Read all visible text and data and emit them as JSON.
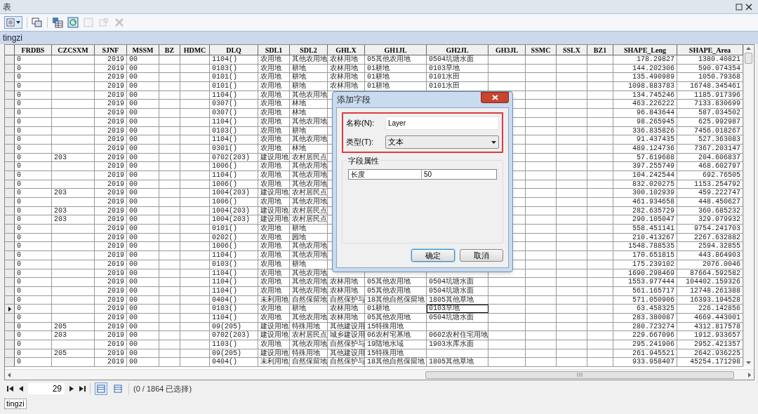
{
  "window": {
    "title": "表"
  },
  "table_tab": "tingzi",
  "columns": [
    {
      "label": "FRDBS",
      "kind": "text",
      "focused": false
    },
    {
      "label": "CZCSXM",
      "kind": "text",
      "focused": false
    },
    {
      "label": "SJNF",
      "kind": "number",
      "focused": false
    },
    {
      "label": "MSSM",
      "kind": "text",
      "focused": false
    },
    {
      "label": "BZ",
      "kind": "text",
      "focused": false
    },
    {
      "label": "HDMC",
      "kind": "text",
      "focused": false
    },
    {
      "label": "DLQ",
      "kind": "text",
      "focused": false
    },
    {
      "label": "SDL1",
      "kind": "text",
      "focused": false
    },
    {
      "label": "SDL2",
      "kind": "text",
      "focused": false
    },
    {
      "label": "GHLX",
      "kind": "text",
      "focused": false
    },
    {
      "label": "GH1JL",
      "kind": "text",
      "focused": false
    },
    {
      "label": "GH2JL",
      "kind": "text",
      "focused": true
    },
    {
      "label": "GH3JL",
      "kind": "text",
      "focused": false
    },
    {
      "label": "SSMC",
      "kind": "text",
      "focused": false
    },
    {
      "label": "SSLX",
      "kind": "text",
      "focused": false
    },
    {
      "label": "BZ1",
      "kind": "text",
      "focused": false
    },
    {
      "label": "SHAPE_Leng",
      "kind": "number",
      "focused": false
    },
    {
      "label": "SHAPE_Area",
      "kind": "number",
      "focused": false
    }
  ],
  "rows": [
    {
      "current": false,
      "cells": [
        "0",
        null,
        "2019",
        "00",
        null,
        null,
        "1104()",
        "农用地",
        "其他农用地",
        "农林用地",
        "05其他农用地",
        "0504坑塘水面",
        null,
        null,
        null,
        null,
        "178.29827",
        "1380.40821"
      ]
    },
    {
      "current": false,
      "cells": [
        "0",
        null,
        "2019",
        "00",
        null,
        null,
        "0103()",
        "农用地",
        "耕地",
        "农林用地",
        "01耕地",
        "0103旱地",
        null,
        null,
        null,
        null,
        "144.202306",
        "590.074354"
      ]
    },
    {
      "current": false,
      "cells": [
        "0",
        null,
        "2019",
        "00",
        null,
        null,
        "0101()",
        "农用地",
        "耕地",
        "农林用地",
        "01耕地",
        "0101水田",
        null,
        null,
        null,
        null,
        "135.490989",
        "1050.79368"
      ]
    },
    {
      "current": false,
      "cells": [
        "0",
        null,
        "2019",
        "00",
        null,
        null,
        "0101()",
        "农用地",
        "耕地",
        "农林用地",
        "01耕地",
        "0101水田",
        null,
        null,
        null,
        null,
        "1098.883783",
        "16748.345461"
      ]
    },
    {
      "current": false,
      "cells": [
        "0",
        null,
        "2019",
        "00",
        null,
        null,
        "1104()",
        "农用地",
        "其他农用地",
        null,
        null,
        null,
        null,
        null,
        null,
        null,
        "134.745246",
        "1185.917396"
      ]
    },
    {
      "current": false,
      "cells": [
        "0",
        null,
        "2019",
        "00",
        null,
        null,
        "0307()",
        "农用地",
        "林地",
        null,
        null,
        null,
        null,
        null,
        null,
        null,
        "463.226222",
        "7133.830699"
      ]
    },
    {
      "current": false,
      "cells": [
        "0",
        null,
        "2019",
        "00",
        null,
        null,
        "0307()",
        "农用地",
        "林地",
        null,
        null,
        null,
        null,
        null,
        null,
        null,
        "96.843644",
        "587.034502"
      ]
    },
    {
      "current": false,
      "cells": [
        "0",
        null,
        "2019",
        "00",
        null,
        null,
        "1104()",
        "农用地",
        "其他农用地",
        null,
        null,
        null,
        null,
        null,
        null,
        null,
        "98.265945",
        "625.992987"
      ]
    },
    {
      "current": false,
      "cells": [
        "0",
        null,
        "2019",
        "00",
        null,
        null,
        "0103()",
        "农用地",
        "耕地",
        null,
        null,
        null,
        null,
        null,
        null,
        null,
        "336.835826",
        "7456.018267"
      ]
    },
    {
      "current": false,
      "cells": [
        "0",
        null,
        "2019",
        "00",
        null,
        null,
        "1104()",
        "农用地",
        "其他农用地",
        null,
        null,
        null,
        null,
        null,
        null,
        null,
        "91.437435",
        "527.363083"
      ]
    },
    {
      "current": false,
      "cells": [
        "0",
        null,
        "2019",
        "00",
        null,
        null,
        "0301()",
        "农用地",
        "林地",
        null,
        null,
        null,
        null,
        null,
        null,
        null,
        "489.124736",
        "7367.203147"
      ]
    },
    {
      "current": false,
      "cells": [
        "0",
        "203",
        "2019",
        "00",
        null,
        null,
        "0702(203)",
        "建设用地",
        "农村居民点",
        null,
        null,
        null,
        null,
        null,
        null,
        null,
        "57.619688",
        "204.606837"
      ]
    },
    {
      "current": false,
      "cells": [
        "0",
        null,
        "2019",
        "00",
        null,
        null,
        "1006()",
        "农用地",
        "其他农用地",
        null,
        null,
        null,
        null,
        null,
        null,
        null,
        "397.255749",
        "468.602797"
      ]
    },
    {
      "current": false,
      "cells": [
        "0",
        null,
        "2019",
        "00",
        null,
        null,
        "1104()",
        "农用地",
        "其他农用地",
        null,
        null,
        null,
        null,
        null,
        null,
        null,
        "104.242544",
        "692.76505"
      ]
    },
    {
      "current": false,
      "cells": [
        "0",
        null,
        "2019",
        "00",
        null,
        null,
        "1006()",
        "农用地",
        "其他农用地",
        null,
        null,
        null,
        null,
        null,
        null,
        null,
        "832.020275",
        "1153.254792"
      ]
    },
    {
      "current": false,
      "cells": [
        "0",
        "203",
        "2019",
        "00",
        null,
        null,
        "1004(203)",
        "建设用地",
        "农村居民点",
        null,
        null,
        null,
        null,
        null,
        null,
        null,
        "300.102939",
        "459.222747"
      ]
    },
    {
      "current": false,
      "cells": [
        "0",
        null,
        "2019",
        "00",
        null,
        null,
        "1006()",
        "农用地",
        "其他农用地",
        null,
        null,
        null,
        null,
        null,
        null,
        null,
        "461.934658",
        "448.450627"
      ]
    },
    {
      "current": false,
      "cells": [
        "0",
        "203",
        "2019",
        "00",
        null,
        null,
        "1004(203)",
        "建设用地",
        "农村居民点",
        null,
        null,
        null,
        null,
        null,
        null,
        null,
        "282.635729",
        "360.685232"
      ]
    },
    {
      "current": false,
      "cells": [
        "0",
        "203",
        "2019",
        "00",
        null,
        null,
        "1004(203)",
        "建设用地",
        "农村居民点",
        null,
        null,
        null,
        null,
        null,
        null,
        null,
        "290.105047",
        "329.079932"
      ]
    },
    {
      "current": false,
      "cells": [
        "0",
        null,
        "2019",
        "00",
        null,
        null,
        "0101()",
        "农用地",
        "耕地",
        null,
        null,
        null,
        null,
        null,
        null,
        null,
        "558.451141",
        "9754.241703"
      ]
    },
    {
      "current": false,
      "cells": [
        "0",
        null,
        "2019",
        "00",
        null,
        null,
        "0202()",
        "农用地",
        "园地",
        null,
        null,
        null,
        null,
        null,
        null,
        null,
        "210.413267",
        "2267.632882"
      ]
    },
    {
      "current": false,
      "cells": [
        "0",
        null,
        "2019",
        "00",
        null,
        null,
        "1006()",
        "农用地",
        "其他农用地",
        null,
        null,
        null,
        null,
        null,
        null,
        null,
        "1548.788535",
        "2594.32855"
      ]
    },
    {
      "current": false,
      "cells": [
        "0",
        null,
        "2019",
        "00",
        null,
        null,
        "1104()",
        "农用地",
        "其他农用地",
        null,
        null,
        null,
        null,
        null,
        null,
        null,
        "170.651815",
        "443.864903"
      ]
    },
    {
      "current": false,
      "cells": [
        "0",
        null,
        "2019",
        "00",
        null,
        null,
        "0103()",
        "农用地",
        "耕地",
        null,
        null,
        null,
        null,
        null,
        null,
        null,
        "175.239102",
        "2076.0046"
      ]
    },
    {
      "current": false,
      "cells": [
        "0",
        null,
        "2019",
        "00",
        null,
        null,
        "1104()",
        "农用地",
        "其他农用地",
        null,
        null,
        null,
        null,
        null,
        null,
        null,
        "1690.298469",
        "87664.592582"
      ]
    },
    {
      "current": false,
      "cells": [
        "0",
        null,
        "2019",
        "00",
        null,
        null,
        "1104()",
        "农用地",
        "其他农用地",
        "农林用地",
        "05其他农用地",
        "0504坑塘水面",
        null,
        null,
        null,
        null,
        "1553.977444",
        "104402.159326"
      ]
    },
    {
      "current": false,
      "cells": [
        "0",
        null,
        "2019",
        "00",
        null,
        null,
        "1104()",
        "农用地",
        "其他农用地",
        "农林用地",
        "05其他农用地",
        "0504坑塘水面",
        null,
        null,
        null,
        null,
        "561.165717",
        "12748.261388"
      ]
    },
    {
      "current": false,
      "cells": [
        "0",
        null,
        "2019",
        "00",
        null,
        null,
        "0404()",
        "未利用地",
        "自然保留地",
        "自然保护与",
        "18其他自然保留地",
        "1805其他草地",
        null,
        null,
        null,
        null,
        "571.050906",
        "16393.194528"
      ]
    },
    {
      "current": true,
      "cells": [
        "0",
        null,
        "2019",
        "00",
        null,
        null,
        "0103()",
        "农用地",
        "耕地",
        "农林用地",
        "01耕地",
        "0103旱地",
        null,
        null,
        null,
        null,
        "63.458325",
        "226.142856"
      ]
    },
    {
      "current": false,
      "cells": [
        "0",
        null,
        "2019",
        "00",
        null,
        null,
        "1104()",
        "农用地",
        "其他农用地",
        "农林用地",
        "05其他农用地",
        "0504坑塘水面",
        null,
        null,
        null,
        null,
        "283.380087",
        "4669.443001"
      ]
    },
    {
      "current": false,
      "cells": [
        "0",
        "205",
        "2019",
        "00",
        null,
        null,
        "09(205)",
        "建设用地",
        "特殊用地",
        "其他建设用",
        "15特殊用地",
        null,
        null,
        null,
        null,
        null,
        "280.723274",
        "4312.817578"
      ]
    },
    {
      "current": false,
      "cells": [
        "0",
        "203",
        "2019",
        "00",
        null,
        null,
        "0702(203)",
        "建设用地",
        "农村居民点",
        "城乡建设用",
        "06农村宅基地",
        "0602农村住宅用地",
        null,
        null,
        null,
        null,
        "229.667096",
        "1912.933657"
      ]
    },
    {
      "current": false,
      "cells": [
        "0",
        null,
        "2019",
        "00",
        null,
        null,
        "1103()",
        "农用地",
        "其他农用地",
        "自然保护与",
        "19陆地水域",
        "1903水库水面",
        null,
        null,
        null,
        null,
        "295.241906",
        "2952.421357"
      ]
    },
    {
      "current": false,
      "cells": [
        "0",
        "205",
        "2019",
        "00",
        null,
        null,
        "09(205)",
        "建设用地",
        "特殊用地",
        "其他建设用",
        "15特殊用地",
        null,
        null,
        null,
        null,
        null,
        "261.945521",
        "2642.936225"
      ]
    },
    {
      "current": false,
      "cells": [
        "0",
        null,
        "2019",
        "00",
        null,
        null,
        "0404()",
        "未利用地",
        "自然保留地",
        "自然保护与",
        "18其他自然保留地",
        "1805其他草地",
        null,
        null,
        null,
        null,
        "933.958407",
        "45254.171298"
      ]
    }
  ],
  "dialog": {
    "title": "添加字段",
    "fields_highlighted": true,
    "name_field": {
      "label": "名称(N):",
      "value": "Layer"
    },
    "type_field": {
      "label": "类型(T):",
      "value": "文本"
    },
    "group": {
      "title": "字段属性",
      "properties": [
        {
          "name": "长度",
          "value": "50"
        }
      ]
    },
    "buttons": [
      {
        "label": "确定",
        "default": true
      },
      {
        "label": "取消",
        "default": false
      }
    ]
  },
  "navigator": {
    "record": "29",
    "views": [
      {
        "selected": true
      },
      {
        "selected": false
      }
    ],
    "status": "(0 / 1864 已选择)"
  },
  "bottom_tab": "tingzi"
}
